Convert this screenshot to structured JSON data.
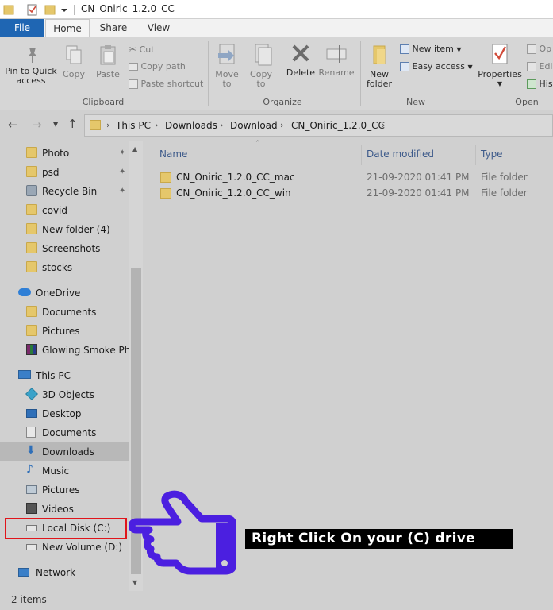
{
  "window": {
    "title": "CN_Oniric_1.2.0_CC"
  },
  "tabs": [
    {
      "label": "File"
    },
    {
      "label": "Home"
    },
    {
      "label": "Share"
    },
    {
      "label": "View"
    }
  ],
  "ribbon": {
    "clipboard": {
      "pin_label": "Pin to Quick access",
      "copy_label": "Copy",
      "paste_label": "Paste",
      "cut_label": "Cut",
      "copy_path_label": "Copy path",
      "paste_shortcut_label": "Paste shortcut",
      "group_label": "Clipboard"
    },
    "organize": {
      "move_to_label": "Move to",
      "copy_to_label": "Copy to",
      "delete_label": "Delete",
      "rename_label": "Rename",
      "group_label": "Organize"
    },
    "new": {
      "new_folder_label": "New folder",
      "new_item_label": "New item",
      "easy_access_label": "Easy access",
      "group_label": "New"
    },
    "open": {
      "properties_label": "Properties",
      "open_label": "Op",
      "edit_label": "Edi",
      "history_label": "His",
      "group_label": "Open"
    }
  },
  "breadcrumb": [
    "This PC",
    "Downloads",
    "Download",
    "CN_Oniric_1.2.0_CC"
  ],
  "nav": {
    "quick_access": [
      {
        "label": "Photo",
        "pinned": true
      },
      {
        "label": "psd",
        "pinned": true
      },
      {
        "label": "Recycle Bin",
        "pinned": true
      },
      {
        "label": "covid",
        "pinned": false
      },
      {
        "label": "New folder (4)",
        "pinned": false
      },
      {
        "label": "Screenshots",
        "pinned": false
      },
      {
        "label": "stocks",
        "pinned": false
      }
    ],
    "onedrive": {
      "label": "OneDrive",
      "items": [
        "Documents",
        "Pictures",
        "Glowing Smoke Phot"
      ]
    },
    "this_pc": {
      "label": "This PC",
      "items": [
        "3D Objects",
        "Desktop",
        "Documents",
        "Downloads",
        "Music",
        "Pictures",
        "Videos",
        "Local Disk (C:)",
        "New Volume (D:)"
      ]
    },
    "network": {
      "label": "Network"
    }
  },
  "columns": {
    "name": "Name",
    "date": "Date modified",
    "type": "Type"
  },
  "files": [
    {
      "name": "CN_Oniric_1.2.0_CC_mac",
      "date": "21-09-2020 01:41 PM",
      "type": "File folder"
    },
    {
      "name": "CN_Oniric_1.2.0_CC_win",
      "date": "21-09-2020 01:41 PM",
      "type": "File folder"
    }
  ],
  "status": {
    "items": "2 items"
  },
  "annotation": {
    "callout_text": "Right Click On your (C) drive"
  },
  "colors": {
    "file_tab": "#1f66b3",
    "highlight": "#e0151b",
    "hand": "#4b1fe0"
  }
}
